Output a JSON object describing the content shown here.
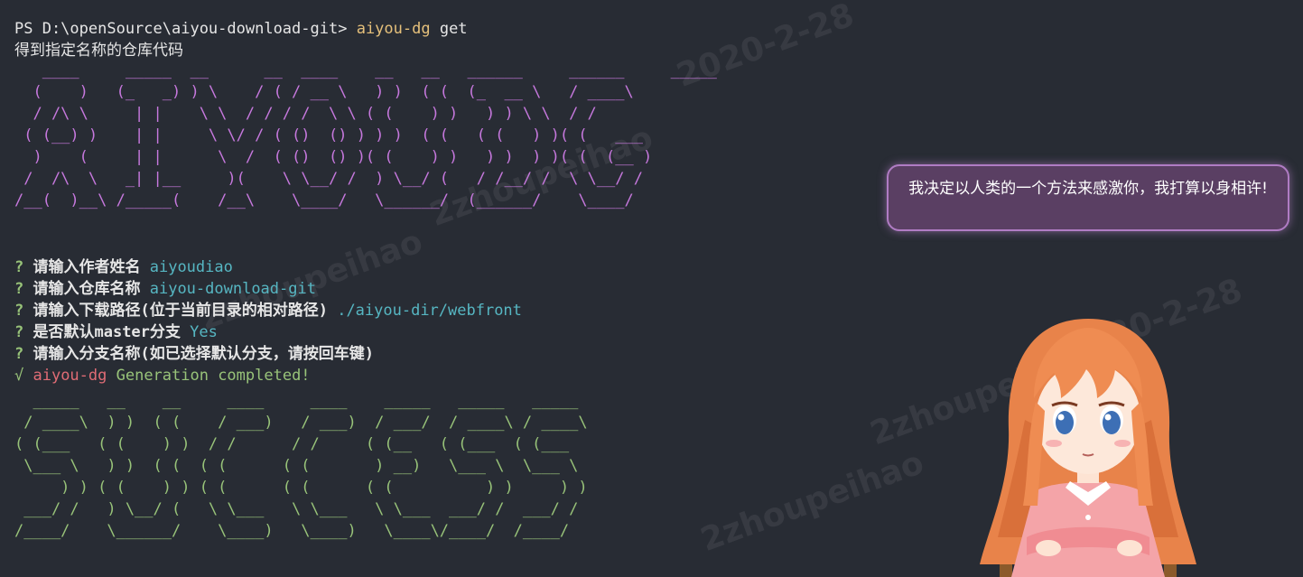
{
  "command": {
    "prompt": "PS D:\\openSource\\aiyou-download-git> ",
    "cmd": "aiyou-dg",
    "arg": " get"
  },
  "description": "得到指定名称的仓库代码",
  "banner": {
    "logo_art": "   ____     _____  __      __  ____    __   __   ______     ______     _____\n  (    )   (_   _) ) \\    / ( / __ \\   ) )  ( (  (_  __ \\   / ____\\\n  / /\\ \\     | |    \\ \\  / / / /  \\ \\ ( (    ) )   ) ) \\ \\  / /     \n ( (__) )    | |     \\ \\/ / ( ()  () ) ) )  ( (   ( (   ) )( (   ___\n  )    (     | |      \\  /  ( ()  () )( (    ) )   ) )  ) )( (  (__ )\n /  /\\  \\   _| |__     )(    \\ \\__/ /  ) \\__/ (   / /__/ /  \\ \\__/ /\n/__(  )__\\ /_____(    /__\\    \\____/   \\______/  (______/    \\____/",
    "success_art": "  _____   __    __     ____     ____    _____   _____   _____\n / ____\\  ) )  ( (    / ___)   / ___)  / ___/  / ____\\ / ____\\\n( (___   ( (    ) )  / /      / /     ( (__   ( (___  ( (___\n \\___ \\   ) )  ( (  ( (      ( (       ) __)   \\___ \\  \\___ \\\n     ) ) ( (    ) ) ( (      ( (      ( (          ) )     ) )\n ___/ /   ) \\__/ (   \\ \\___   \\ \\___   \\ \\___  ___/ /  ___/ /\n/____/    \\______/    \\____)   \\____)   \\____\\/____/  /____/"
  },
  "questions": [
    {
      "mark": "?",
      "text": " 请输入作者姓名 ",
      "answer": "aiyoudiao"
    },
    {
      "mark": "?",
      "text": " 请输入仓库名称 ",
      "answer": "aiyou-download-git"
    },
    {
      "mark": "?",
      "text": " 请输入下载路径(位于当前目录的相对路径) ",
      "answer": "./aiyou-dir/webfront"
    },
    {
      "mark": "?",
      "text": " 是否默认master分支 ",
      "answer": "Yes"
    },
    {
      "mark": "?",
      "text": " 请输入分支名称(如已选择默认分支，请按回车键)",
      "answer": ""
    }
  ],
  "completion": {
    "mark": "√",
    "name": " aiyou-dg",
    "text": " Generation completed!"
  },
  "speech_bubble": "我决定以人类的一个方法来感激你，我打算以身相许!",
  "watermarks": [
    "2020-2-28",
    "2zhoupeihao",
    "2zhoupeihao",
    "2020-2-28",
    "2zhoupei",
    "2zhoupeihao"
  ],
  "colors": {
    "background": "#282c34",
    "command": "#e5c07b",
    "logo": "#c678dd",
    "success": "#98c379",
    "answer": "#56b6c2",
    "error_name": "#e06c75",
    "bubble_bg": "#5a3f63",
    "bubble_border": "#b07cc4"
  }
}
